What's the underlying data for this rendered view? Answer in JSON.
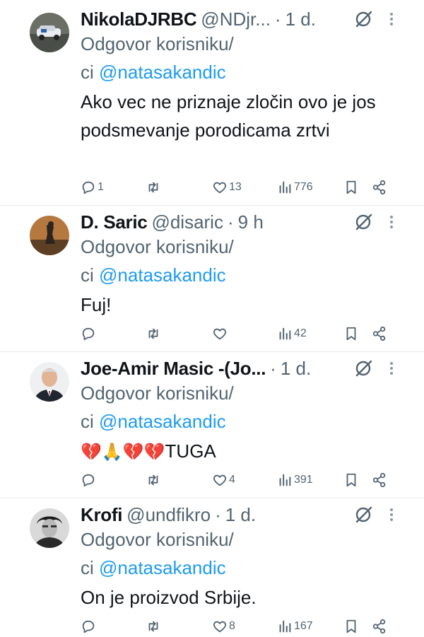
{
  "tweets": [
    {
      "name": "NikolaDJRBC",
      "handle": "@NDjr...",
      "time": "1 d.",
      "reply_prefix": "Odgovor korisniku/",
      "reply_prefix2": "ci",
      "reply_to": "@natasakandic",
      "text": "Ako vec ne priznaje zločin ovo je jos podsmevanje porodicama zrtvi",
      "replies": "1",
      "reposts": "",
      "likes": "13",
      "views": "776"
    },
    {
      "name": "D. Saric",
      "handle": "@disaric",
      "time": "9 h",
      "reply_prefix": "Odgovor korisniku/",
      "reply_prefix2": "ci",
      "reply_to": "@natasakandic",
      "text": "Fuj!",
      "replies": "",
      "reposts": "",
      "likes": "",
      "views": "42"
    },
    {
      "name": "Joe-Amir Masic -(Jo...",
      "handle": "",
      "time": "1 d.",
      "reply_prefix": "Odgovor korisniku/",
      "reply_prefix2": "ci",
      "reply_to": "@natasakandic",
      "text_emoji": "💔🙏💔💔",
      "text": "TUGA",
      "replies": "",
      "reposts": "",
      "likes": "4",
      "views": "391"
    },
    {
      "name": "Krofi",
      "handle": "@undfikro",
      "time": "1 d.",
      "reply_prefix": "Odgovor korisniku/",
      "reply_prefix2": "ci",
      "reply_to": "@natasakandic",
      "text": "On je proizvod Srbije.",
      "replies": "",
      "reposts": "",
      "likes": "8",
      "views": "167"
    }
  ],
  "icons": {
    "reply": "reply-icon",
    "repost": "repost-icon",
    "like": "heart-icon",
    "views": "views-icon",
    "bookmark": "bookmark-icon",
    "share": "share-icon",
    "grok": "grok-icon",
    "more": "more-icon"
  },
  "colors": {
    "mention": "#1d9bf0",
    "secondary": "#536471",
    "text": "#0f1419",
    "divider": "#e6e9eb"
  }
}
